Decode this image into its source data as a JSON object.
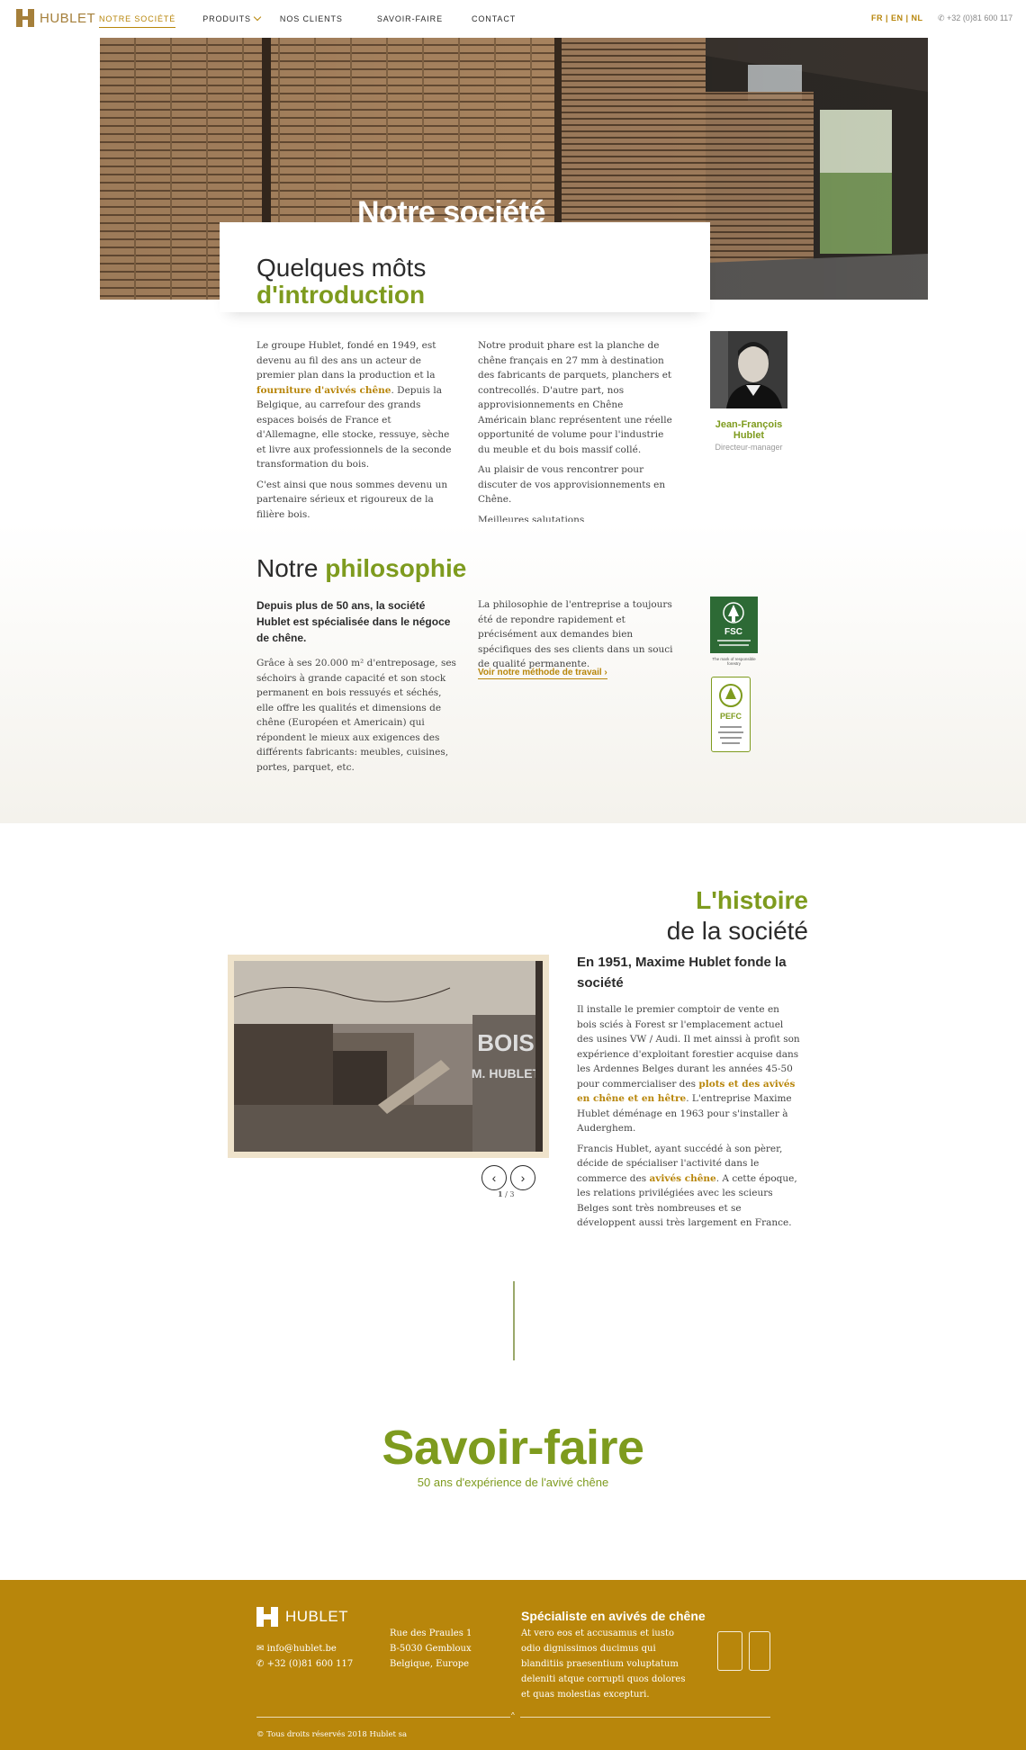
{
  "nav": {
    "logo": "HUBLET",
    "items": [
      "NOTRE SOCIÉTÉ",
      "PRODUITS",
      "NOS CLIENTS",
      "SAVOIR-FAIRE",
      "CONTACT"
    ],
    "langs": "FR | EN | NL",
    "phone": "+32 (0)81 600 117"
  },
  "hero": {
    "title": "Notre société"
  },
  "intro": {
    "title_line1": "Quelques môts",
    "title_line2": "d'introduction",
    "col1_p1_a": "Le groupe Hublet, fondé en 1949, est devenu au fil des ans un acteur de premier plan dans la production et la ",
    "col1_p1_link": "fourniture d'avivés chêne",
    "col1_p1_b": ". Depuis la Belgique, au carrefour des grands espaces boisés de France et d'Allemagne, elle stocke, ressuye, sèche et livre aux professionnels de la seconde transformation du bois.",
    "col1_p2": "C'est ainsi que nous sommes devenu un partenaire sérieux et rigoureux de la filière bois.",
    "col2_p1": "Notre produit phare est la planche de chêne français en 27 mm à destination des fabricants de parquets, planchers et contrecollés. D'autre part, nos approvisionnements en Chêne Américain blanc représentent une réelle opportunité de volume pour l'industrie du meuble et du bois massif collé.",
    "col2_p2": "Au plaisir de vous rencontrer pour discuter de vos approvisionnements en Chêne.",
    "col2_p3": "Meilleures salutations,",
    "person_name": "Jean-François Hublet",
    "person_role": "Directeur-manager"
  },
  "philosophy": {
    "title_a": "Notre ",
    "title_b": "philosophie",
    "lead": "Depuis plus de 50 ans, la société Hublet est spécialisée dans le négoce de chêne.",
    "col1": "Grâce à ses 20.000 m² d'entreposage, ses séchoirs à grande capacité et son stock permanent en bois ressuyés et séchés, elle offre les qualités et dimensions de chêne (Européen et Americain) qui répondent le mieux aux exigences des différents fabricants: meubles, cuisines, portes, parquet, etc.",
    "col2": "La philosophie de l'entreprise a toujours été de repondre rapidement et précisément aux demandes bien spécifiques des ses clients dans un souci de qualité permanente.",
    "link": "Voir notre méthode de travail",
    "fsc_label": "FSC",
    "fsc_caption": "The mark of responsible forestry",
    "pefc_label": "PEFC"
  },
  "history": {
    "title_a": "L'histoire",
    "title_b": "de la société",
    "lead": "En 1951, Maxime Hublet fonde la société",
    "p1_a": "Il installe le premier comptoir de vente en bois sciés à Forest sr l'emplacement actuel des usines VW / Audi. Il met ainssi à profit son expérience d'exploitant forestier acquise dans les Ardennes Belges durant les années 45-50 pour commercialiser des ",
    "p1_link": "plots et des avivés en chêne et en hêtre",
    "p1_b": ". L'entreprise Maxime Hublet déménage en 1963 pour s'installer à Auderghem.",
    "p2_a": "Francis Hublet, ayant succédé à son pèrer, décide de spécialiser l'activité dans le commerce des ",
    "p2_link": "avivés chêne",
    "p2_b": ". A cette époque, les relations privilégiées avec les scieurs Belges sont très nombreuses et se développent aussi très largement en France.",
    "photo_sign_1": "BOIS",
    "photo_sign_2": "M. HUBLET",
    "pager_current": "1",
    "pager_total": "3"
  },
  "savoir": {
    "title": "Savoir-faire",
    "subtitle": "50 ans d'expérience de l'avivé chêne"
  },
  "footer": {
    "logo": "HUBLET",
    "email": "info@hublet.be",
    "phone": "+32 (0)81 600 117",
    "addr1": "Rue des Praules 1",
    "addr2": "B-5030 Gembloux",
    "addr3": "Belgique, Europe",
    "heading": "Spécialiste en avivés de chêne",
    "text": "At vero eos et accusamus et iusto odio dignissimos ducimus qui blanditiis praesentium voluptatum deleniti atque corrupti quos dolores et quas molestias excepturi.",
    "copyright": "© Tous droits réservés 2018 Hublet sa"
  },
  "colors": {
    "gold": "#b8860b",
    "green": "#7e9b1e",
    "fsc_green": "#2d6a35"
  }
}
